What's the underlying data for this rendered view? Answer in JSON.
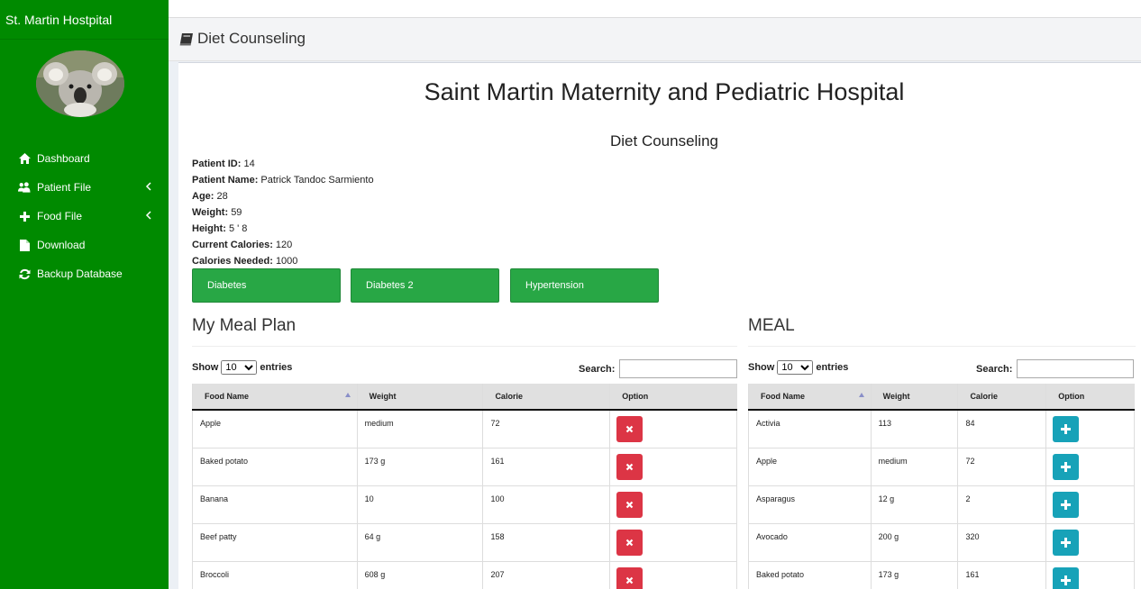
{
  "sidebar": {
    "brand": "St. Martin Hostpital",
    "items": [
      {
        "label": "Dashboard",
        "icon": "home-icon"
      },
      {
        "label": "Patient File",
        "icon": "users-icon",
        "has_submenu": true
      },
      {
        "label": "Food File",
        "icon": "plus-icon",
        "has_submenu": true
      },
      {
        "label": "Download",
        "icon": "file-icon"
      },
      {
        "label": "Backup Database",
        "icon": "refresh-icon"
      }
    ]
  },
  "header": {
    "title": "Diet Counseling",
    "icon": "book-icon"
  },
  "main": {
    "hospital_title": "Saint Martin Maternity and Pediatric Hospital",
    "subtitle": "Diet Counseling",
    "patient": [
      {
        "label": "Patient ID:",
        "value": "14"
      },
      {
        "label": "Patient Name:",
        "value": "Patrick Tandoc Sarmiento"
      },
      {
        "label": "Age:",
        "value": "28"
      },
      {
        "label": "Weight:",
        "value": "59"
      },
      {
        "label": "Height:",
        "value": "5 ' 8"
      },
      {
        "label": "Current Calories:",
        "value": "120"
      },
      {
        "label": "Calories Needed:",
        "value": "1000"
      }
    ],
    "conditions": [
      "Diabetes",
      "Diabetes 2",
      "Hypertension"
    ]
  },
  "meal_plan": {
    "title": "My Meal Plan",
    "show_label": "Show",
    "entries_label": "entries",
    "page_size": "10",
    "search_label": "Search:",
    "columns": [
      "Food Name",
      "Weight",
      "Calorie",
      "Option"
    ],
    "rows": [
      [
        "Apple",
        "medium",
        "72"
      ],
      [
        "Baked potato",
        "173 g",
        "161"
      ],
      [
        "Banana",
        "10",
        "100"
      ],
      [
        "Beef patty",
        "64 g",
        "158"
      ],
      [
        "Broccoli",
        "608 g",
        "207"
      ]
    ]
  },
  "meal": {
    "title": "MEAL",
    "show_label": "Show",
    "entries_label": "entries",
    "page_size": "10",
    "search_label": "Search:",
    "columns": [
      "Food Name",
      "Weight",
      "Calorie",
      "Option"
    ],
    "rows": [
      [
        "Activia",
        "113",
        "84"
      ],
      [
        "Apple",
        "medium",
        "72"
      ],
      [
        "Asparagus",
        "12 g",
        "2"
      ],
      [
        "Avocado",
        "200 g",
        "320"
      ],
      [
        "Baked potato",
        "173 g",
        "161"
      ]
    ]
  },
  "colors": {
    "sidebar": "#008a00",
    "condition_button": "#28a745",
    "delete_button": "#dc3545",
    "add_button": "#17a2b8"
  }
}
